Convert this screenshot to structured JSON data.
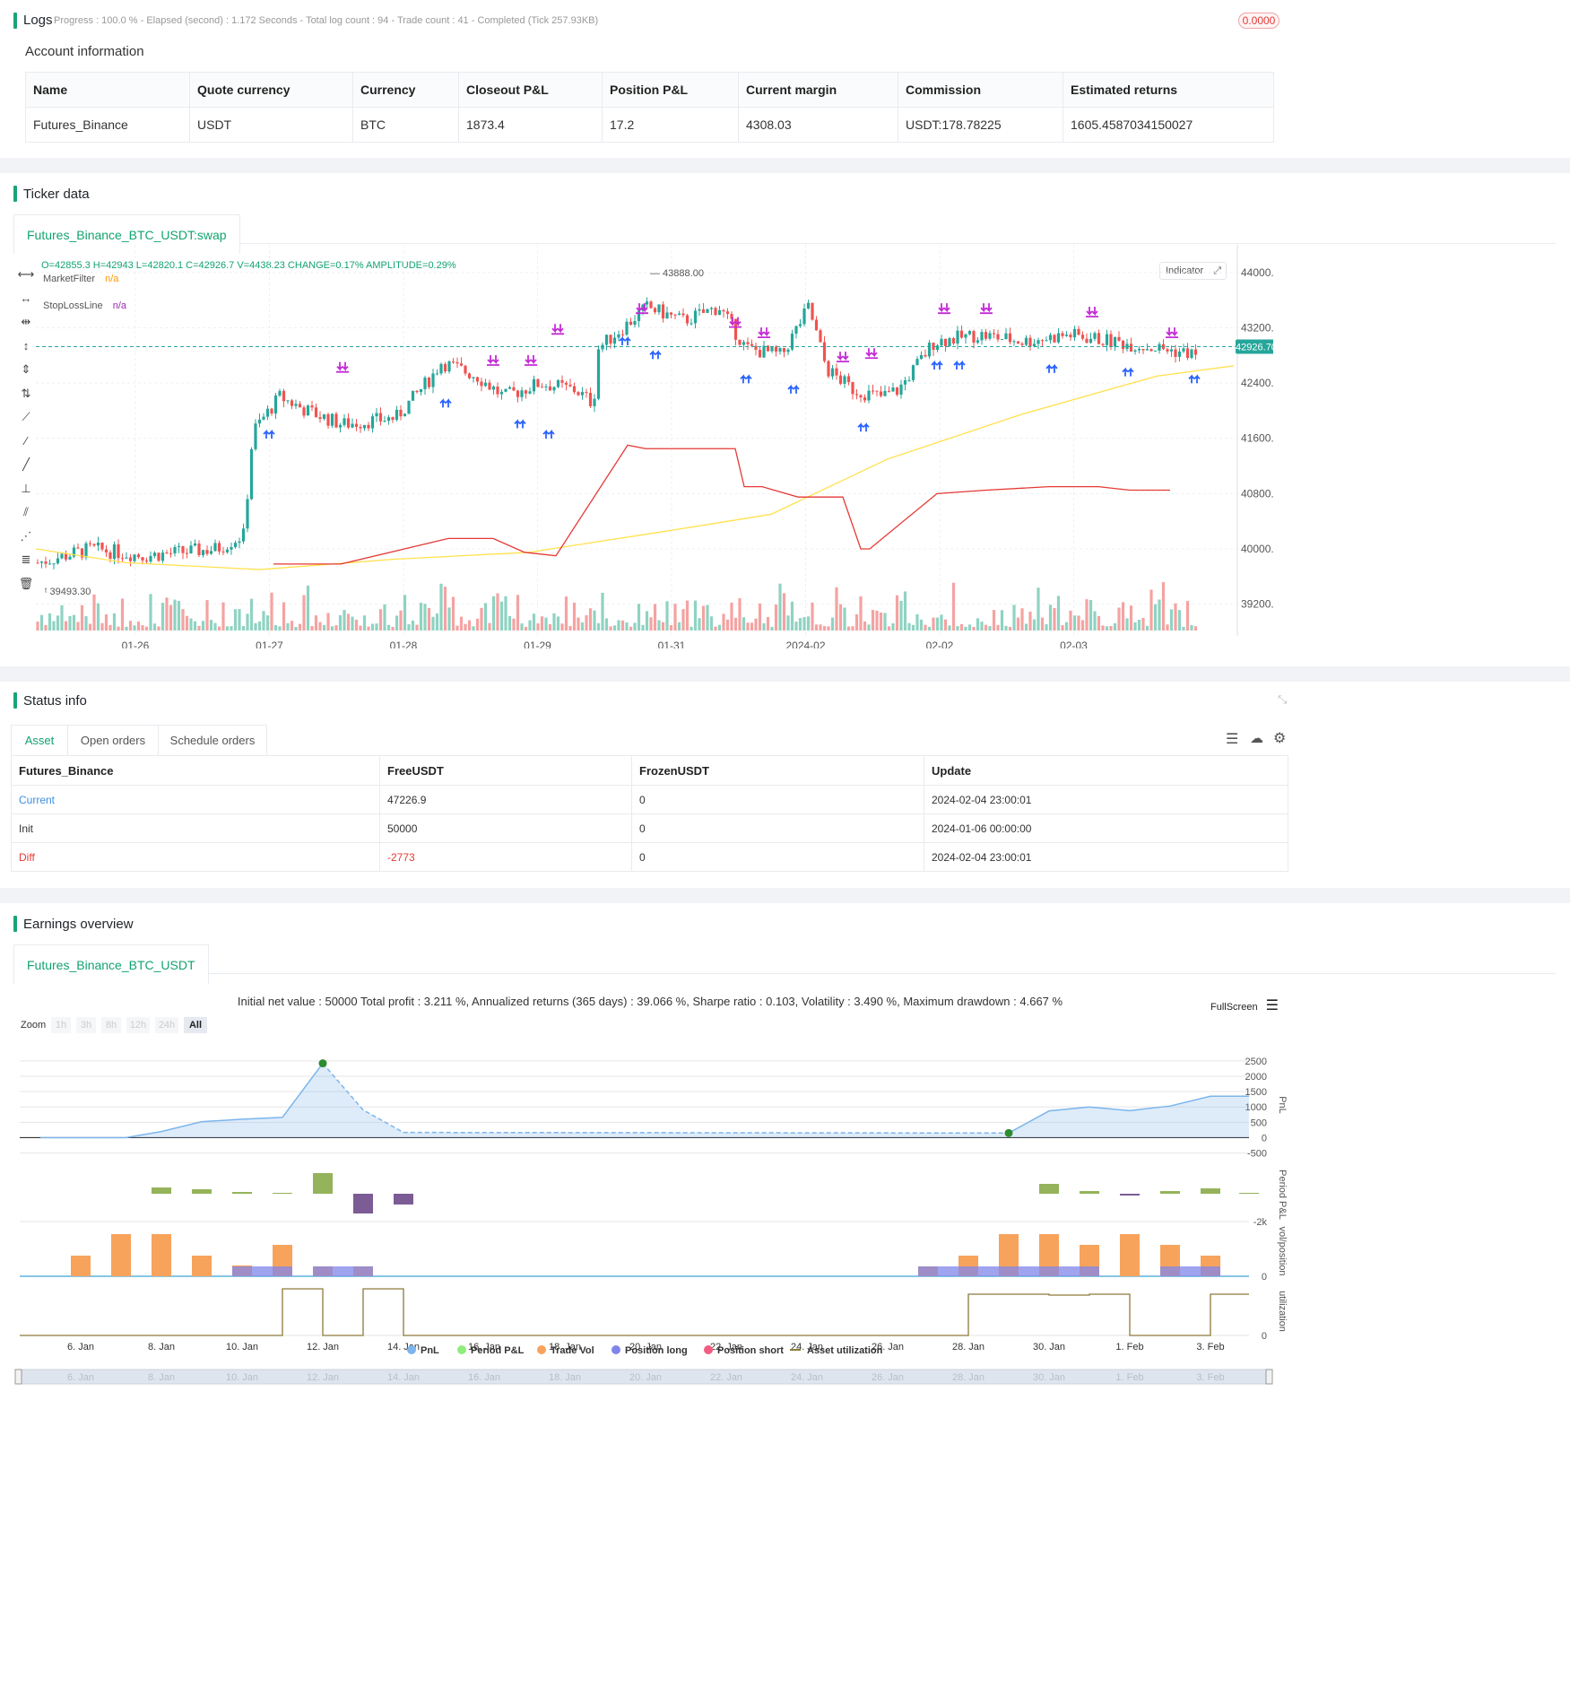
{
  "logs": {
    "title": "Logs",
    "progress": "Progress : 100.0 % - Elapsed (second) : 1.172  Seconds - Total log count : 94 - Trade count : 41 - Completed (Tick 257.93KB)",
    "badge": "0.0000"
  },
  "account": {
    "title": "Account information",
    "headers": [
      "Name",
      "Quote currency",
      "Currency",
      "Closeout P&L",
      "Position P&L",
      "Current margin",
      "Commission",
      "Estimated returns"
    ],
    "row": [
      "Futures_Binance",
      "USDT",
      "BTC",
      "1873.4",
      "17.2",
      "4308.03",
      "USDT:178.78225",
      "1605.4587034150027"
    ]
  },
  "ticker": {
    "title": "Ticker data",
    "tab": "Futures_Binance_BTC_USDT:swap",
    "ohlc": "O=42855.3 H=42943 L=42820.1 C=42926.7 V=4438.23 CHANGE=0.17% AMPLITUDE=0.29%",
    "ind1": "MarketFilter",
    "ind1v": "n/a",
    "ind2": "StopLossLine",
    "ind2v": "n/a",
    "indicator_btn": "Indicator",
    "price_tag": "42926.70",
    "high_label": "43888.00",
    "low_label": "39493.30",
    "yticks": [
      "44000.00",
      "43200.00",
      "42400.00",
      "41600.00",
      "40800.00",
      "40000.00",
      "39200.00"
    ],
    "xticks": [
      "01-26",
      "01-27",
      "01-28",
      "01-29",
      "01-31",
      "2024-02",
      "02-02",
      "02-03"
    ],
    "colors": {
      "up": "#26a69a",
      "down": "#ef5350",
      "ma": "#ffe14d",
      "stop": "#e53935"
    }
  },
  "status": {
    "title": "Status info",
    "tabs": [
      "Asset",
      "Open orders",
      "Schedule orders"
    ],
    "headers": [
      "Futures_Binance",
      "FreeUSDT",
      "FrozenUSDT",
      "Update"
    ],
    "rows": [
      [
        "Current",
        "47226.9",
        "0",
        "2024-02-04 23:00:01"
      ],
      [
        "Init",
        "50000",
        "0",
        "2024-01-06 00:00:00"
      ],
      [
        "Diff",
        "-2773",
        "0",
        "2024-02-04 23:00:01"
      ]
    ]
  },
  "earnings": {
    "title": "Earnings overview",
    "tab": "Futures_Binance_BTC_USDT",
    "summary": "Initial net value : 50000 Total profit : 3.211 %, Annualized returns (365 days) : 39.066 %, Sharpe ratio : 0.103, Volatility : 3.490 %, Maximum drawdown : 4.667 %",
    "fullscreen": "FullScreen",
    "zoom": "Zoom",
    "zoom_opts": [
      "1h",
      "3h",
      "8h",
      "12h",
      "24h",
      "All"
    ],
    "pnl_ticks": [
      "2500",
      "2000",
      "1500",
      "1000",
      "500",
      "0",
      "-500"
    ],
    "period_ticks": [
      "-2k"
    ],
    "vol_ticks": [
      "0"
    ],
    "util_ticks": [
      "0"
    ],
    "axis_titles": [
      "PnL",
      "Period P&L",
      "vol/position",
      "utilization"
    ],
    "xticks": [
      "6. Jan",
      "8. Jan",
      "10. Jan",
      "12. Jan",
      "14. Jan",
      "16. Jan",
      "18. Jan",
      "20. Jan",
      "22. Jan",
      "24. Jan",
      "26. Jan",
      "28. Jan",
      "30. Jan",
      "1. Feb",
      "3. Feb"
    ],
    "legend": [
      "PnL",
      "Period P&L",
      "Trade Vol",
      "Position long",
      "Position short",
      "Asset utilization"
    ],
    "legend_colors": [
      "#7cb5ec",
      "#90ed7d",
      "#f7a35c",
      "#8085e9",
      "#f15c80",
      "#8d7a3b"
    ]
  }
}
